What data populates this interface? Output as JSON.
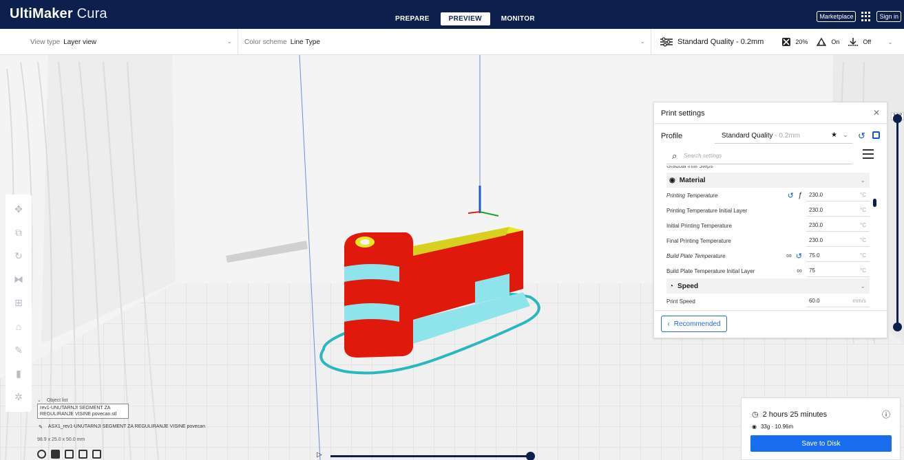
{
  "header": {
    "logo_bold": "UltiMaker",
    "logo_light": " Cura",
    "tabs": [
      "PREPARE",
      "PREVIEW",
      "MONITOR"
    ],
    "active_tab": "PREVIEW",
    "marketplace": "Marketplace",
    "sign_in": "Sign in"
  },
  "toolbar": {
    "view_type_label": "View type",
    "view_type_value": "Layer view",
    "color_scheme_label": "Color scheme",
    "color_scheme_value": "Line Type",
    "quality": "Standard Quality - 0.2mm",
    "infill": "20%",
    "support": "On",
    "adhesion": "Off"
  },
  "left_tools": [
    "move-icon",
    "scale-icon",
    "rotate-icon",
    "mirror-icon",
    "per-model-settings-icon",
    "support-blocker-icon",
    "paint-icon",
    "mesh-icon",
    "extruder-icon"
  ],
  "print_settings": {
    "title": "Print settings",
    "profile_label": "Profile",
    "profile_value": "Standard Quality",
    "profile_suffix": " - 0.2mm",
    "search_placeholder": "Search settings",
    "clipped_row": "Gradual Infill Steps",
    "material_category": "Material",
    "rows": [
      {
        "name": "Printing Temperature",
        "value": "230.0",
        "unit": "°C"
      },
      {
        "name": "Printing Temperature Initial Layer",
        "value": "230.0",
        "unit": "°C"
      },
      {
        "name": "Initial Printing Temperature",
        "value": "230.0",
        "unit": "°C"
      },
      {
        "name": "Final Printing Temperature",
        "value": "230.0",
        "unit": "°C"
      },
      {
        "name": "Build Plate Temperature",
        "value": "75.0",
        "unit": "°C"
      },
      {
        "name": "Build Plate Temperature Initial Layer",
        "value": "75",
        "unit": "°C"
      }
    ],
    "speed_category": "Speed",
    "speed_row": {
      "name": "Print Speed",
      "value": "60.0",
      "unit": "mm/s"
    },
    "recommended_button": "Recommended"
  },
  "layer_slider": {
    "label": "167"
  },
  "object_list": {
    "header": "Object list",
    "selected_name": "rev1-UNUTARNJI SEGMENT ZA REGULIRANJE VISINE povecan.stl",
    "object_line": "ASX1_rev1-UNUTARNJI SEGMENT ZA REGULIRANJE VISINE povecan",
    "dimensions": "98.9 x 25.0 x 50.0 mm"
  },
  "output": {
    "time": "2 hours 25 minutes",
    "material": "33g · 10.96m",
    "save_button": "Save to Disk"
  },
  "colors": {
    "header_bg": "#0d1f4c",
    "accent": "#196ef0",
    "wall_red": "#e0190d",
    "top_yellow": "#e8e822",
    "infill_cyan": "#6fe0e8"
  }
}
